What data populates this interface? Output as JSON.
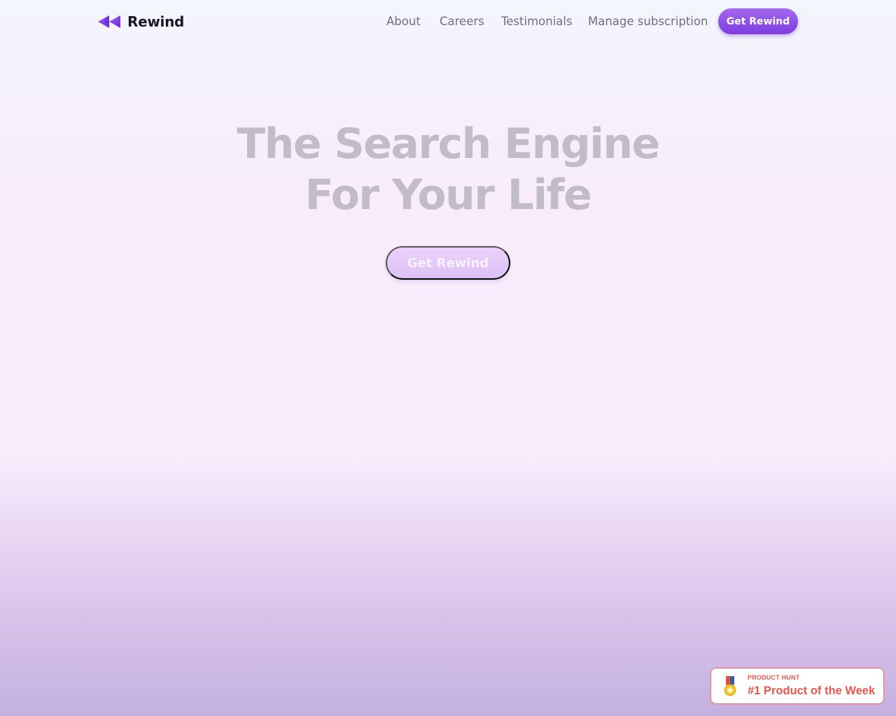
{
  "brand": {
    "name": "Rewind",
    "logo_icon": "rewind-icon",
    "logo_colors": [
      "#7b35e6",
      "#a35cf0"
    ]
  },
  "nav": {
    "links": [
      {
        "label": "About"
      },
      {
        "label": "Careers"
      },
      {
        "label": "Testimonials"
      },
      {
        "label": "Manage subscription"
      }
    ],
    "cta_label": "Get Rewind"
  },
  "hero": {
    "title_line1": "The Search Engine",
    "title_line2": "For Your Life",
    "cta_label": "Get Rewind"
  },
  "product_hunt_badge": {
    "kicker": "PRODUCT HUNT",
    "title": "#1 Product of the Week",
    "icon": "medal-icon",
    "accent_color": "#e9574a"
  },
  "colors": {
    "accent": "#8b4ae8",
    "title_text": "#c2bbca",
    "nav_text": "#6f6f7f"
  }
}
